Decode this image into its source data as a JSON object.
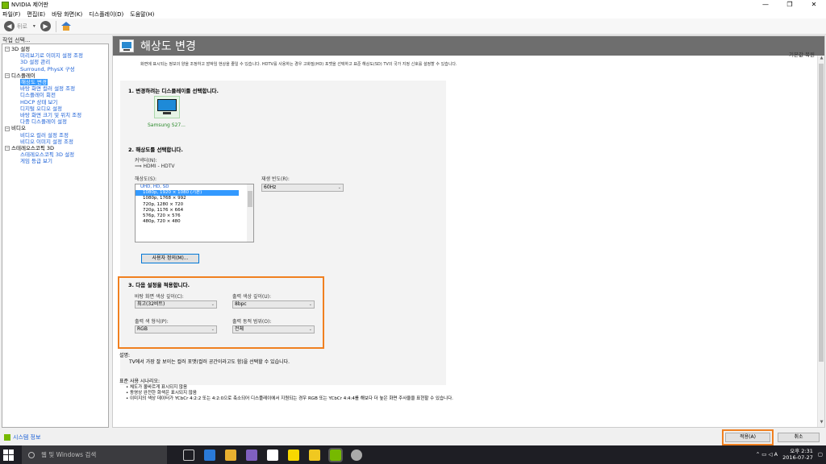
{
  "window": {
    "title": "NVIDIA 제어판",
    "min": "—",
    "max": "❐",
    "close": "✕"
  },
  "menu": [
    "파일(F)",
    "편집(E)",
    "바탕 화면(K)",
    "디스플레이(D)",
    "도움말(H)"
  ],
  "toolbar": {
    "back_label": "뒤로"
  },
  "left": {
    "task_label": "작업 선택...",
    "tree": [
      {
        "type": "cat",
        "label": "3D 설정",
        "box": "−"
      },
      {
        "type": "item",
        "label": "미리보기로 이미지 설정 조정"
      },
      {
        "type": "item",
        "label": "3D 설정 관리"
      },
      {
        "type": "item",
        "label": "Surround, PhysX 구성"
      },
      {
        "type": "cat",
        "label": "디스플레이",
        "box": "−"
      },
      {
        "type": "item",
        "label": "해상도 변경",
        "selected": true
      },
      {
        "type": "item",
        "label": "바탕 화면 컬러 설정 조정"
      },
      {
        "type": "item",
        "label": "디스플레이 회전"
      },
      {
        "type": "item",
        "label": "HDCP 상태 보기"
      },
      {
        "type": "item",
        "label": "디지털 오디오 설정"
      },
      {
        "type": "item",
        "label": "바탕 화면 크기 및 위치 조정"
      },
      {
        "type": "item",
        "label": "다중 디스플레이 설정"
      },
      {
        "type": "cat",
        "label": "비디오",
        "box": "−"
      },
      {
        "type": "item",
        "label": "비디오 컬러 설정 조정"
      },
      {
        "type": "item",
        "label": "비디오 이미지 설정 조정"
      },
      {
        "type": "cat",
        "label": "스테레오스코픽 3D",
        "box": "−"
      },
      {
        "type": "item",
        "label": "스테레오스코픽 3D 설정"
      },
      {
        "type": "item",
        "label": "게임 등급 보기"
      }
    ],
    "system_info": "시스템 정보"
  },
  "page": {
    "title": "해상도 변경",
    "restore_defaults": "기본값 복원",
    "description": "화면에 표시되는 정보의 양을 조정하고 깜박임 현상을 줄일 수 있습니다. HDTV를 사용하는 경우 고화질(HD) 포맷을 선택하고 표준 해상도(SD) TV의 국가 지정 신호를 설정할 수 있습니다.",
    "step1": "1. 변경하려는 디스플레이를 선택합니다.",
    "monitor_label": "Samsung S27...",
    "step2": "2. 해상도를 선택합니다.",
    "connector_label": "커넥터(N):",
    "connector_value": "HDMI - HDTV",
    "resolution_label": "해상도(S):",
    "refresh_label": "재생 빈도(R):",
    "refresh_value": "60Hz",
    "resolutions": [
      {
        "label": "UHD, HD, SD",
        "header": true
      },
      {
        "label": "1080p, 1920 × 1080 (기본)",
        "selected": true
      },
      {
        "label": "1080p, 1768 × 992"
      },
      {
        "label": "720p, 1280 × 720"
      },
      {
        "label": "720p, 1176 × 664"
      },
      {
        "label": "576p, 720 × 576"
      },
      {
        "label": "480p, 720 × 480"
      }
    ],
    "customize_button": "사용자 정의(M)...",
    "step3": "3. 다음 설정을 적용합니다.",
    "desktop_depth_label": "바탕 화면 색상 깊이(C):",
    "desktop_depth_value": "최고(32비트)",
    "output_depth_label": "출력 색상 깊이(U):",
    "output_depth_value": "8bpc",
    "output_format_label": "출력 색 형식(P):",
    "output_format_value": "RGB",
    "output_range_label": "출력 동적 범위(O):",
    "output_range_value": "전체",
    "explain_title": "설명:",
    "explain_text": "TV에서 가장 잘 보이는 컬러 포맷(컬러 공간이라고도 함)을 선택할 수 있습니다.",
    "usage_title": "표준 사용 시나리오:",
    "usage": [
      "• 체도가 올바르게 표시되지 않음",
      "• 동영상 완전한 화색은 표시되지 않음",
      "• 이미지의 색상 데이터가 YCbCr 4:2:2 또는 4:2:0으로 축소되어 디스플레이에서 지원되는 경우 RGB 또는 YCbCr 4:4:4를 해보다 더 높은 화면 주사율을 표현할 수 있습니다."
    ],
    "apply_button": "적용(A)",
    "cancel_button": "취소"
  },
  "taskbar": {
    "search_placeholder": "웹 및 Windows 검색",
    "ime": "A",
    "time": "오후 2:31",
    "date": "2016-07-27"
  },
  "colors": {
    "nvidia_green": "#76b900",
    "highlight": "#f08020",
    "selection": "#3399ff"
  }
}
